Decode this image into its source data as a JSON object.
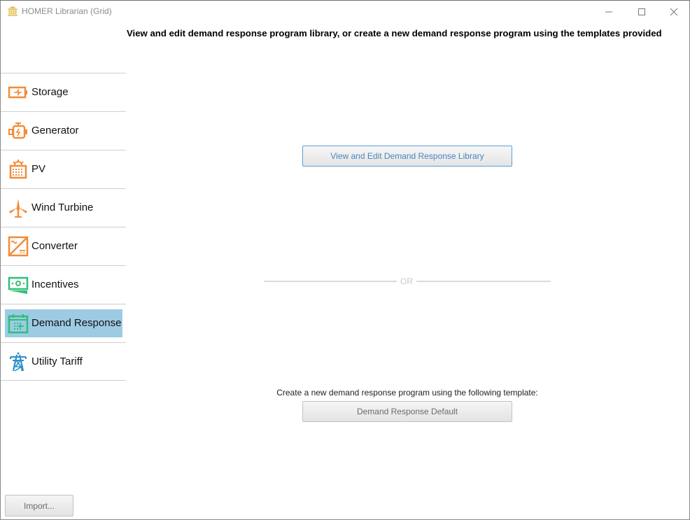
{
  "window": {
    "title": "HOMER Librarian (Grid)",
    "app_icon": "library-building-icon",
    "controls": {
      "minimize": "minimize-icon",
      "maximize": "maximize-icon",
      "close": "close-icon"
    }
  },
  "heading": "View and edit demand response program library, or create a new demand response program using the templates provided",
  "sidebar": {
    "selected": "Demand Response",
    "items": [
      {
        "label": "Storage",
        "icon": "battery-icon",
        "color": "#f28c38"
      },
      {
        "label": "Generator",
        "icon": "generator-engine-icon",
        "color": "#f28c38"
      },
      {
        "label": "PV",
        "icon": "solar-panel-icon",
        "color": "#f28c38"
      },
      {
        "label": "Wind Turbine",
        "icon": "wind-turbine-icon",
        "color": "#f28c38"
      },
      {
        "label": "Converter",
        "icon": "converter-icon",
        "color": "#f28c38"
      },
      {
        "label": "Incentives",
        "icon": "money-bill-icon",
        "color": "#2ebf7a"
      },
      {
        "label": "Demand Response",
        "icon": "calendar-icon",
        "color": "#2ebf7a"
      },
      {
        "label": "Utility Tariff",
        "icon": "power-tower-icon",
        "color": "#2a8fc9"
      }
    ]
  },
  "main": {
    "library_button": "View and Edit Demand Response Library",
    "separator": "OR",
    "template_label": "Create a new demand response program using the following template:",
    "template_button": "Demand Response Default"
  },
  "footer": {
    "import_button": "Import..."
  },
  "colors": {
    "accent_orange": "#f28c38",
    "accent_green": "#2ebf7a",
    "accent_blue": "#2a8fc9",
    "selection": "#9dcbe3",
    "library_button_text": "#4a86be"
  }
}
